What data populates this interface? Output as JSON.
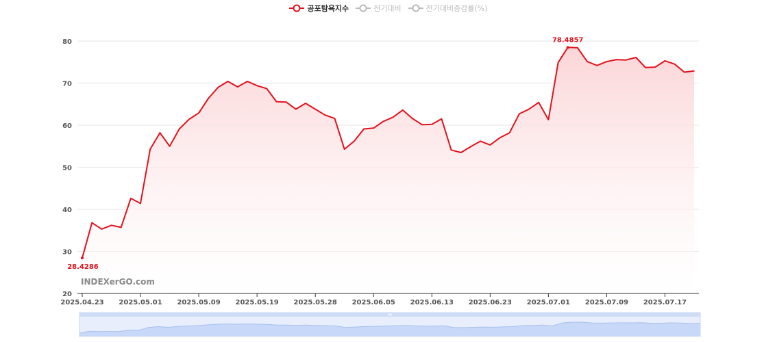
{
  "legend": [
    {
      "label": "공포탐욕지수",
      "active": true,
      "color": "#e3101b"
    },
    {
      "label": "전기대비",
      "active": false,
      "color": "#bbbbbb"
    },
    {
      "label": "전기대비증감률(%)",
      "active": false,
      "color": "#bbbbbb"
    }
  ],
  "watermark": "INDEXerGO.com",
  "colors": {
    "line": "#e3101b",
    "area_top": "#fbd3d5",
    "grid": "#e6e6e6",
    "slider": "#d7e3fb",
    "slider_line": "#a8c0ee"
  },
  "chart_data": {
    "type": "area",
    "title": "",
    "xlabel": "",
    "ylabel": "",
    "ylim": [
      20,
      80
    ],
    "yticks": [
      20,
      30,
      40,
      50,
      60,
      70,
      80
    ],
    "x_tick_labels": [
      "2025.04.23",
      "2025.05.01",
      "2025.05.09",
      "2025.05.19",
      "2025.05.28",
      "2025.06.05",
      "2025.06.13",
      "2025.06.23",
      "2025.07.01",
      "2025.07.09",
      "2025.07.17"
    ],
    "x_tick_indices": [
      0,
      6,
      12,
      18,
      24,
      30,
      36,
      42,
      48,
      54,
      60
    ],
    "series": [
      {
        "name": "공포탐욕지수",
        "values": [
          28.4286,
          36.8,
          35.3,
          36.2,
          35.7,
          42.6,
          41.4,
          54.3,
          58.2,
          55.0,
          59.1,
          61.4,
          62.9,
          66.4,
          69.0,
          70.4,
          69.1,
          70.4,
          69.4,
          68.7,
          65.6,
          65.5,
          63.8,
          65.2,
          63.8,
          62.4,
          61.6,
          54.3,
          56.2,
          59.1,
          59.3,
          60.9,
          61.9,
          63.6,
          61.6,
          60.1,
          60.2,
          61.5,
          54.1,
          53.5,
          54.9,
          56.2,
          55.3,
          57.0,
          58.2,
          62.7,
          63.8,
          65.4,
          61.3,
          74.9,
          78.4857,
          78.4,
          75.1,
          74.2,
          75.1,
          75.6,
          75.5,
          76.1,
          73.7,
          73.8,
          75.3,
          74.5,
          72.6,
          72.9
        ]
      }
    ],
    "annotations": [
      {
        "index": 0,
        "text": "28.4286"
      },
      {
        "index": 50,
        "text": "78.4857"
      }
    ],
    "grid": true,
    "legend_position": "top-center",
    "overview": "dataZoom"
  }
}
